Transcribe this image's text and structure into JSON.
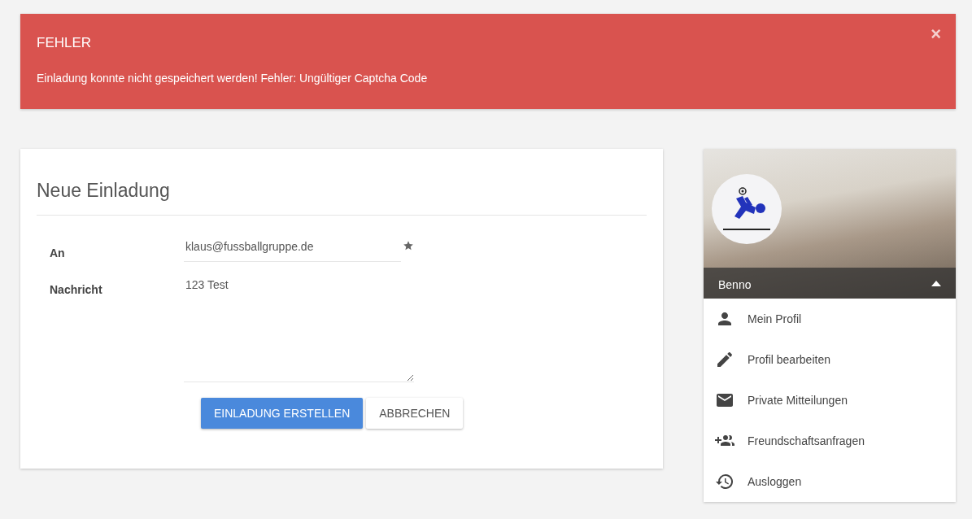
{
  "alert": {
    "title": "FEHLER",
    "message": "Einladung konnte nicht gespeichert werden! Fehler: Ungültiger Captcha Code",
    "close": "×"
  },
  "form": {
    "title": "Neue Einladung",
    "fields": [
      {
        "label": "An",
        "kind": "input",
        "value": "klaus@fussballgruppe.de",
        "starred": true
      },
      {
        "label": "Nachricht",
        "kind": "textarea",
        "value": "123 Test"
      }
    ],
    "buttons": [
      {
        "label": "EINLADUNG ERSTELLEN",
        "kind": "primary"
      },
      {
        "label": "ABBRECHEN",
        "kind": "secondary"
      }
    ]
  },
  "profile": {
    "name": "Benno",
    "expanded": true,
    "menu": [
      {
        "label": "Mein Profil",
        "kind": "person"
      },
      {
        "label": "Profil bearbeiten",
        "kind": "edit"
      },
      {
        "label": "Private Mitteilungen",
        "kind": "mail"
      },
      {
        "label": "Freundschaftsanfragen",
        "kind": "group-add"
      },
      {
        "label": "Ausloggen",
        "kind": "history"
      }
    ]
  }
}
